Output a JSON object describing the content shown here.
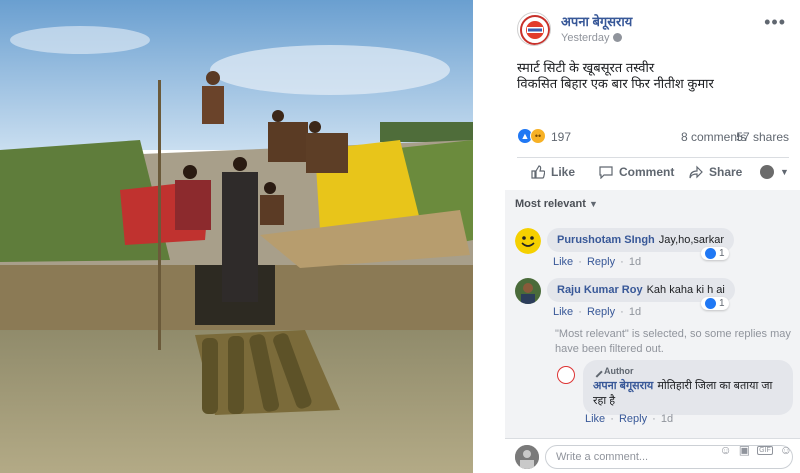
{
  "post": {
    "page_name": "अपना बेगूसराय",
    "time": "Yesterday",
    "text_line1": "स्मार्ट सिटी के खूबसूरत तस्वीर",
    "text_line2": "विकसित बिहार एक बार फिर नीतीश कुमार",
    "reaction_count": "197",
    "comments_count": "8 comments",
    "shares_count": "57 shares",
    "more_icon": "•••"
  },
  "actions": {
    "like": "Like",
    "comment": "Comment",
    "share": "Share"
  },
  "comments_section": {
    "sort_label": "Most relevant",
    "comments": [
      {
        "author": "Purushotam SIngh",
        "text": "Jay,ho,sarkar",
        "likes": "1",
        "like": "Like",
        "reply": "Reply",
        "time": "1d"
      },
      {
        "author": "Raju Kumar Roy",
        "text": "Kah kaha ki h ai",
        "likes": "1",
        "like": "Like",
        "reply": "Reply",
        "time": "1d"
      }
    ],
    "filter_note": "\"Most relevant\" is selected, so some replies may have been filtered out.",
    "reply": {
      "tag": "Author",
      "author": "अपना बेगूसराय",
      "text": "मोतिहारी जिला का बताया जा रहा है",
      "like": "Like",
      "reply": "Reply",
      "time": "1d"
    }
  },
  "composer": {
    "placeholder": "Write a comment..."
  },
  "colors": {
    "link": "#385898",
    "like_blue": "#2078f4",
    "panel_bg": "#f2f3f5"
  }
}
